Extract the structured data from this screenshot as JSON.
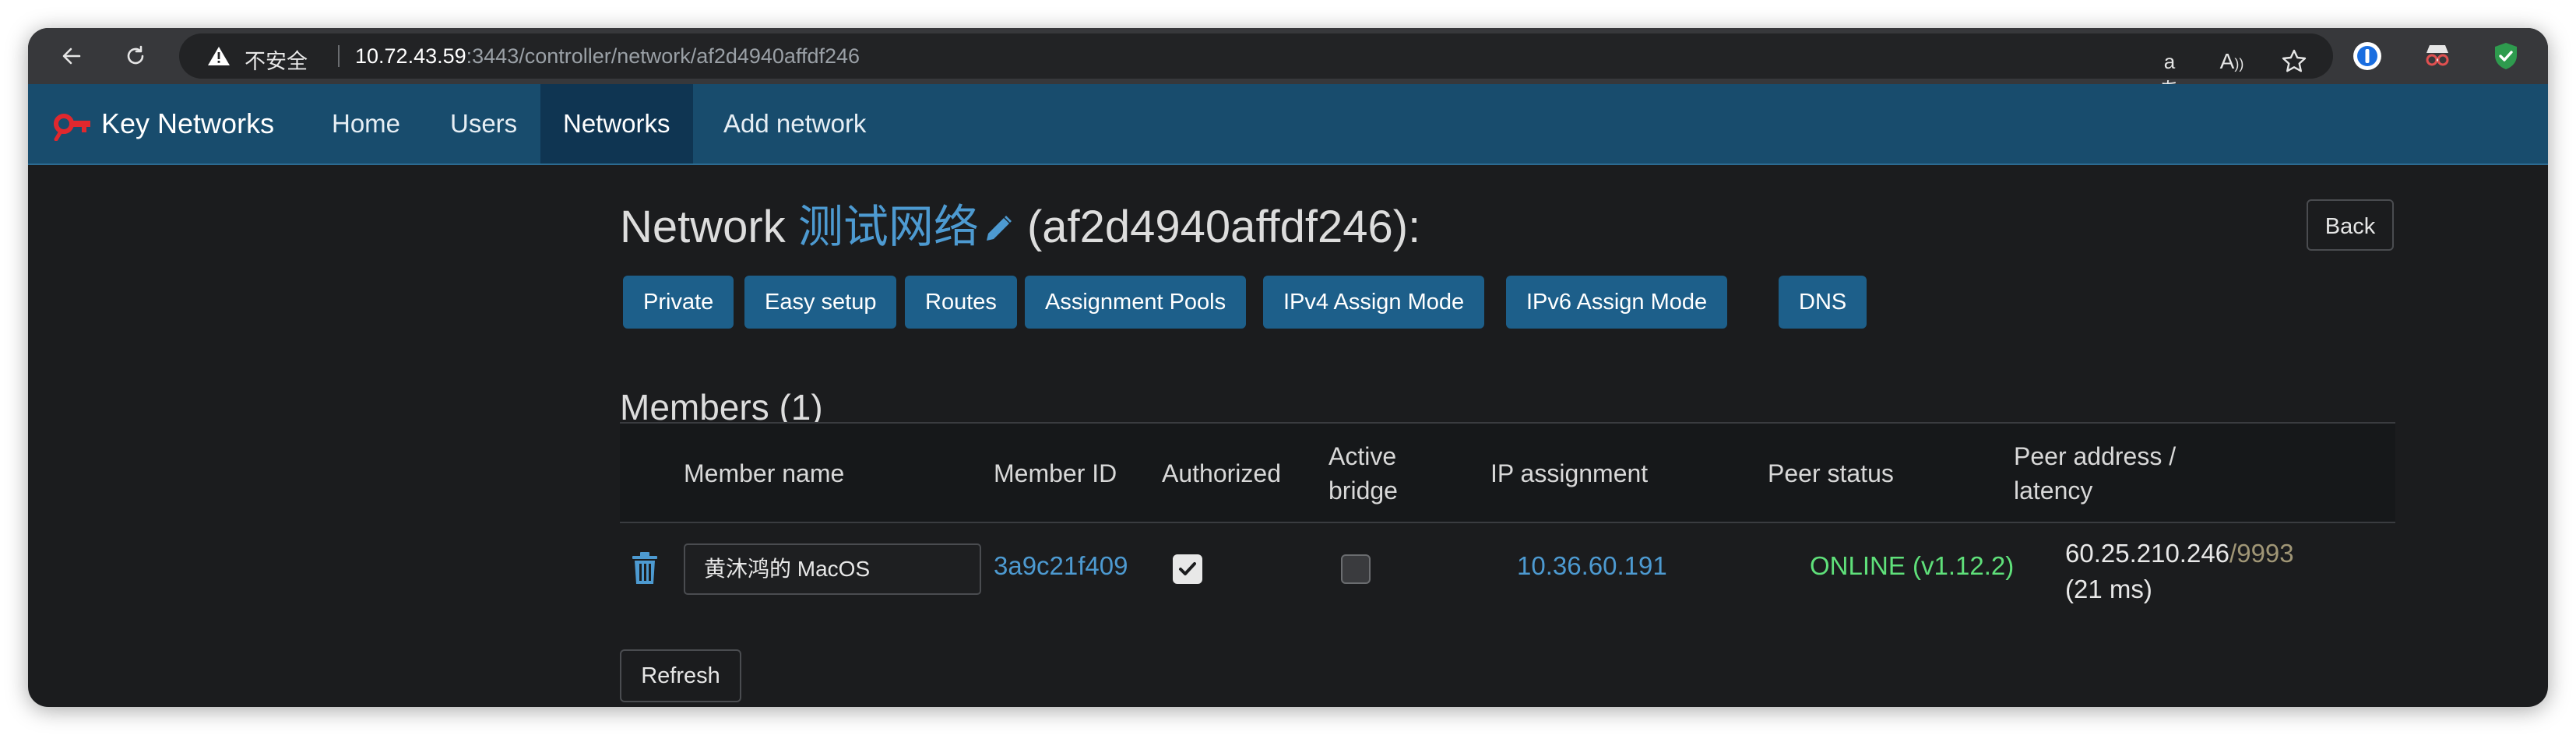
{
  "browser": {
    "security_label": "不安全",
    "url_host": "10.72.43.59",
    "url_rest": ":3443/controller/network/af2d4940affdf246",
    "icons": [
      "back-arrow-icon",
      "reload-icon",
      "warning-icon",
      "translate-icon",
      "read-aloud-icon",
      "star-icon",
      "password-manager-icon",
      "incognito-extension-icon",
      "shield-extension-icon"
    ]
  },
  "nav": {
    "brand": "Key Networks",
    "links": [
      "Home",
      "Users",
      "Networks",
      "Add network"
    ],
    "active": "Networks"
  },
  "page": {
    "title_prefix": "Network ",
    "network_name": "测试网络",
    "title_suffix": " (af2d4940affdf246):",
    "back_label": "Back",
    "action_buttons": [
      "Private",
      "Easy setup",
      "Routes",
      "Assignment Pools",
      "IPv4 Assign Mode",
      "IPv6 Assign Mode",
      "DNS"
    ]
  },
  "members": {
    "heading": "Members (1)",
    "columns": {
      "name": "Member name",
      "id": "Member ID",
      "authorized": "Authorized",
      "bridge_line1": "Active",
      "bridge_line2": "bridge",
      "ip": "IP assignment",
      "status": "Peer status",
      "address_line1": "Peer address /",
      "address_line2": "latency"
    },
    "rows": [
      {
        "name": "黄沐鸿的 MacOS",
        "id": "3a9c21f409",
        "authorized": true,
        "active_bridge": false,
        "ip": "10.36.60.191",
        "status": "ONLINE (v1.12.2)",
        "address": "60.25.210.246",
        "port": "/9993",
        "latency": "(21 ms)"
      }
    ],
    "refresh_label": "Refresh"
  },
  "colors": {
    "navbar": "#184c6d",
    "link": "#4d9ad1",
    "button": "#1d5f8a",
    "online": "#5fe07a"
  }
}
